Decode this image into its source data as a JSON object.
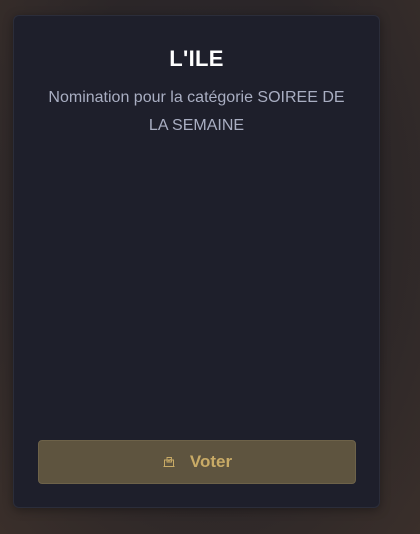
{
  "card": {
    "title": "L'ILE",
    "subtitle": "Nomination pour la catégorie SOIREE DE LA SEMAINE"
  },
  "vote_button": {
    "label": "Voter",
    "icon": "ballot-box-icon"
  },
  "colors": {
    "card_background": "#1e1f2b",
    "title": "#ffffff",
    "subtitle": "#a9aec2",
    "button_background": "#5e543f",
    "button_text": "#c9ab66"
  }
}
